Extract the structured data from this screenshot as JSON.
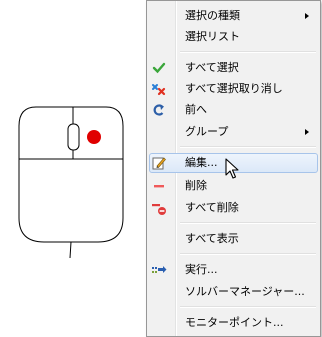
{
  "context_menu": {
    "items": [
      {
        "label": "選択の種類",
        "submenu": true
      },
      {
        "label": "選択リスト"
      },
      {
        "label": "すべて選択",
        "icon": "green-checkmark-icon"
      },
      {
        "label": "すべて選択取り消し",
        "icon": "clear-selection-icon"
      },
      {
        "label": "前へ",
        "icon": "undo-arrow-icon"
      },
      {
        "label": "グループ",
        "submenu": true
      },
      {
        "label": "編集...",
        "icon": "edit-pencil-icon",
        "highlighted": true
      },
      {
        "label": "削除",
        "icon": "red-minus-icon"
      },
      {
        "label": "すべて削除",
        "icon": "delete-all-icon"
      },
      {
        "label": "すべて表示"
      },
      {
        "label": "実行...",
        "icon": "run-arrow-icon"
      },
      {
        "label": "ソルバーマネージャー..."
      },
      {
        "label": "モニターポイント..."
      }
    ]
  },
  "colors": {
    "menu_bg": "#f1f1f1",
    "highlight_border": "#a7c4ea",
    "mouse_button_dot": "#e00000"
  }
}
